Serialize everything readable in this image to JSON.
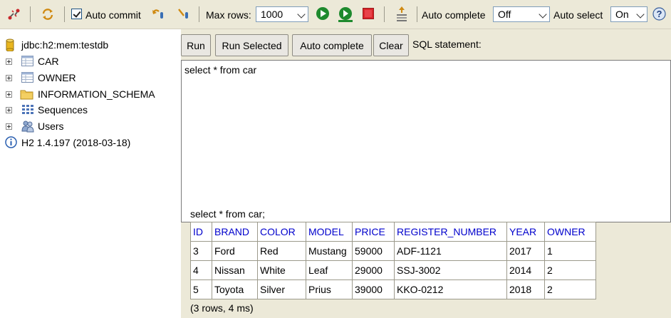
{
  "toolbar": {
    "auto_commit_label": "Auto commit",
    "auto_commit_checked": true,
    "max_rows_label": "Max rows:",
    "max_rows_value": "1000",
    "auto_complete_label": "Auto complete",
    "auto_complete_value": "Off",
    "auto_select_label": "Auto select",
    "auto_select_value": "On",
    "help_glyph": "?"
  },
  "tree": {
    "connection": "jdbc:h2:mem:testdb",
    "items": [
      {
        "label": "CAR",
        "icon": "table-icon"
      },
      {
        "label": "OWNER",
        "icon": "table-icon"
      },
      {
        "label": "INFORMATION_SCHEMA",
        "icon": "folder-icon"
      },
      {
        "label": "Sequences",
        "icon": "sequences-icon"
      },
      {
        "label": "Users",
        "icon": "users-icon"
      }
    ],
    "version": "H2 1.4.197 (2018-03-18)"
  },
  "buttons": {
    "run": "Run",
    "run_selected": "Run Selected",
    "auto_complete": "Auto complete",
    "clear": "Clear"
  },
  "sql_statement_label": "SQL statement:",
  "editor_text": "select * from car",
  "result": {
    "query": "select * from car;",
    "columns": [
      "ID",
      "BRAND",
      "COLOR",
      "MODEL",
      "PRICE",
      "REGISTER_NUMBER",
      "YEAR",
      "OWNER"
    ],
    "rows": [
      [
        "3",
        "Ford",
        "Red",
        "Mustang",
        "59000",
        "ADF-1121",
        "2017",
        "1"
      ],
      [
        "4",
        "Nissan",
        "White",
        "Leaf",
        "29000",
        "SSJ-3002",
        "2014",
        "2"
      ],
      [
        "5",
        "Toyota",
        "Silver",
        "Prius",
        "39000",
        "KKO-0212",
        "2018",
        "2"
      ]
    ],
    "summary": "(3 rows, 4 ms)"
  },
  "colors": {
    "toolbar_bg": "#ece9d8",
    "header_text": "#0000cc",
    "run_green": "#1e8a2e",
    "stop_red": "#d9252a"
  }
}
